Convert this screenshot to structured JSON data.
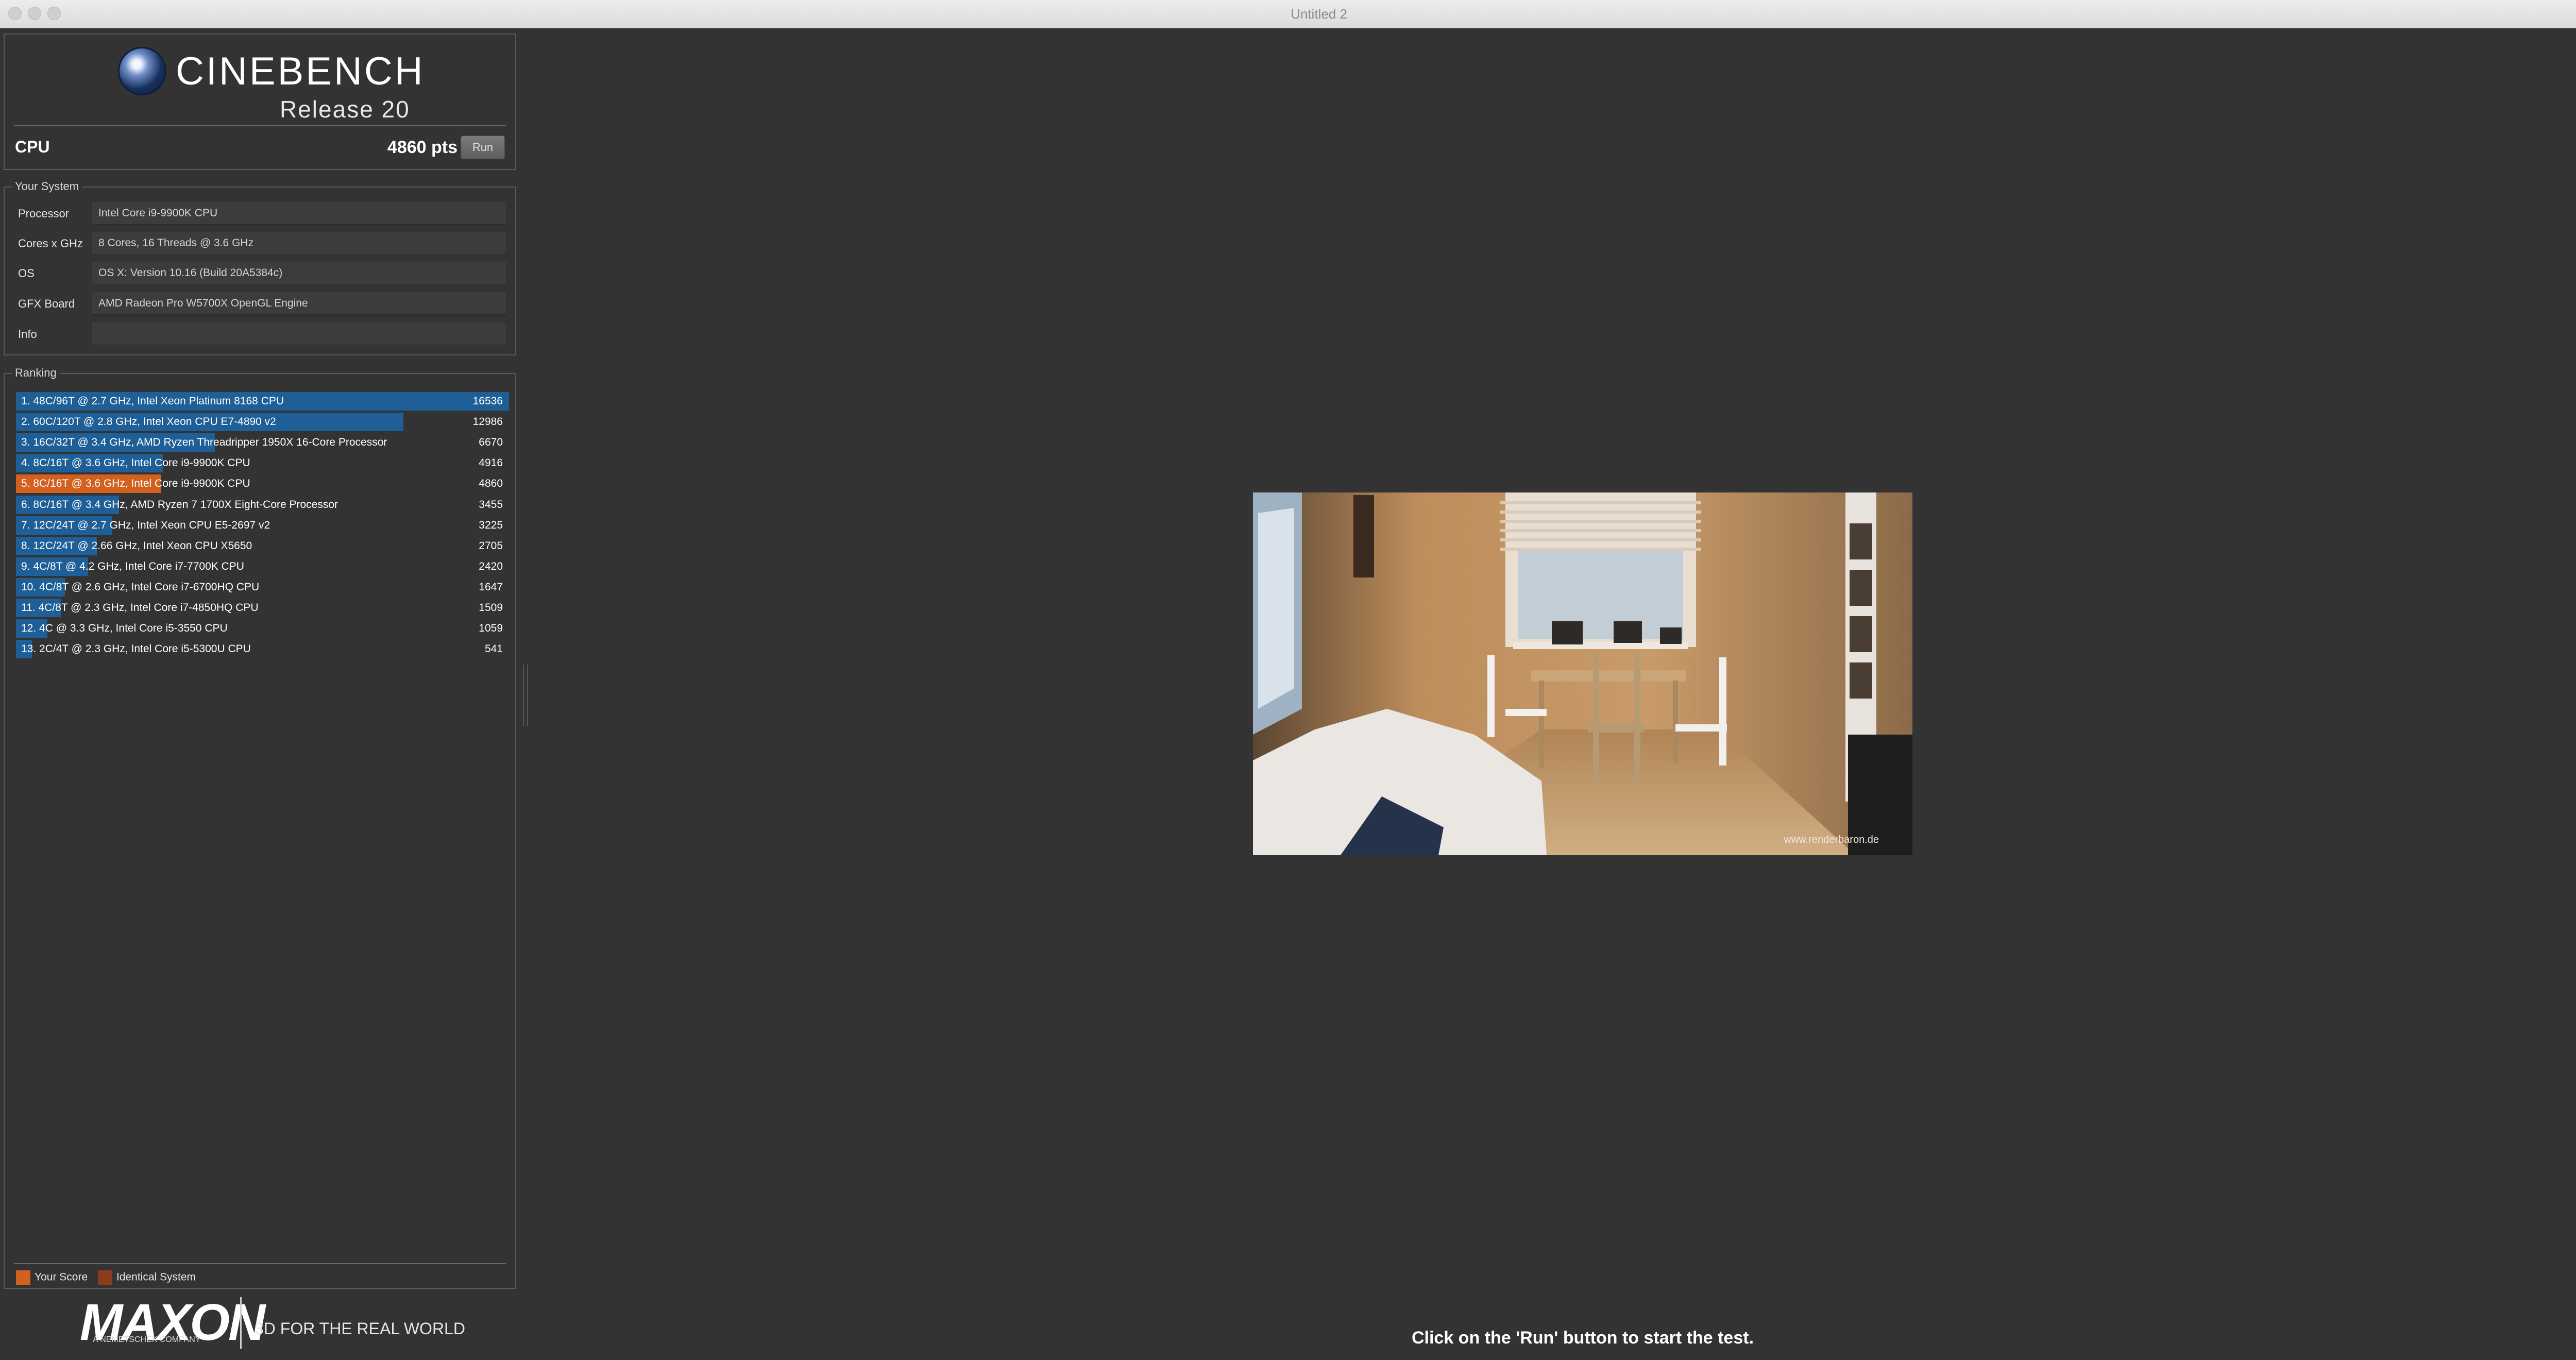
{
  "window": {
    "title": "Untitled 2"
  },
  "header": {
    "app_name": "CINEBENCH",
    "release": "Release 20",
    "test_label": "CPU",
    "score": "4860 pts",
    "run_label": "Run"
  },
  "system": {
    "title": "Your System",
    "rows": [
      {
        "key": "Processor",
        "value": "Intel Core i9-9900K CPU"
      },
      {
        "key": "Cores x GHz",
        "value": "8 Cores, 16 Threads @ 3.6 GHz"
      },
      {
        "key": "OS",
        "value": "OS X: Version 10.16 (Build 20A5384c)"
      },
      {
        "key": "GFX Board",
        "value": "AMD Radeon Pro W5700X OpenGL Engine"
      },
      {
        "key": "Info",
        "value": ""
      }
    ]
  },
  "ranking": {
    "title": "Ranking",
    "items": [
      {
        "label": "1. 48C/96T @ 2.7 GHz, Intel Xeon Platinum 8168 CPU",
        "score": "16536",
        "highlight": false
      },
      {
        "label": "2. 60C/120T @ 2.8 GHz, Intel Xeon CPU E7-4890 v2",
        "score": "12986",
        "highlight": false
      },
      {
        "label": "3. 16C/32T @ 3.4 GHz, AMD Ryzen Threadripper 1950X 16-Core Processor",
        "score": "6670",
        "highlight": false
      },
      {
        "label": "4. 8C/16T @ 3.6 GHz, Intel Core i9-9900K CPU",
        "score": "4916",
        "highlight": false
      },
      {
        "label": "5. 8C/16T @ 3.6 GHz, Intel Core i9-9900K CPU",
        "score": "4860",
        "highlight": true
      },
      {
        "label": "6. 8C/16T @ 3.4 GHz, AMD Ryzen 7 1700X Eight-Core Processor",
        "score": "3455",
        "highlight": false
      },
      {
        "label": "7. 12C/24T @ 2.7 GHz, Intel Xeon CPU E5-2697 v2",
        "score": "3225",
        "highlight": false
      },
      {
        "label": "8. 12C/24T @ 2.66 GHz, Intel Xeon CPU X5650",
        "score": "2705",
        "highlight": false
      },
      {
        "label": "9. 4C/8T @ 4.2 GHz, Intel Core i7-7700K CPU",
        "score": "2420",
        "highlight": false
      },
      {
        "label": "10. 4C/8T @ 2.6 GHz, Intel Core i7-6700HQ CPU",
        "score": "1647",
        "highlight": false
      },
      {
        "label": "11. 4C/8T @ 2.3 GHz, Intel Core i7-4850HQ CPU",
        "score": "1509",
        "highlight": false
      },
      {
        "label": "12. 4C @ 3.3 GHz, Intel Core i5-3550 CPU",
        "score": "1059",
        "highlight": false
      },
      {
        "label": "13. 2C/4T @ 2.3 GHz, Intel Core i5-5300U CPU",
        "score": "541",
        "highlight": false
      }
    ],
    "legend": {
      "your_score": "Your Score",
      "identical": "Identical System"
    }
  },
  "colors": {
    "bar": "#1e5f97",
    "your_score": "#d2601f",
    "identical": "#8a3c1c"
  },
  "footer": {
    "brand": "MAXON",
    "brand_sub": "A NEMETSCHEK COMPANY",
    "tagline": "3D FOR THE REAL WORLD"
  },
  "render": {
    "watermark": "www.renderbaron.de"
  },
  "status": {
    "message": "Click on the 'Run' button to start the test."
  }
}
